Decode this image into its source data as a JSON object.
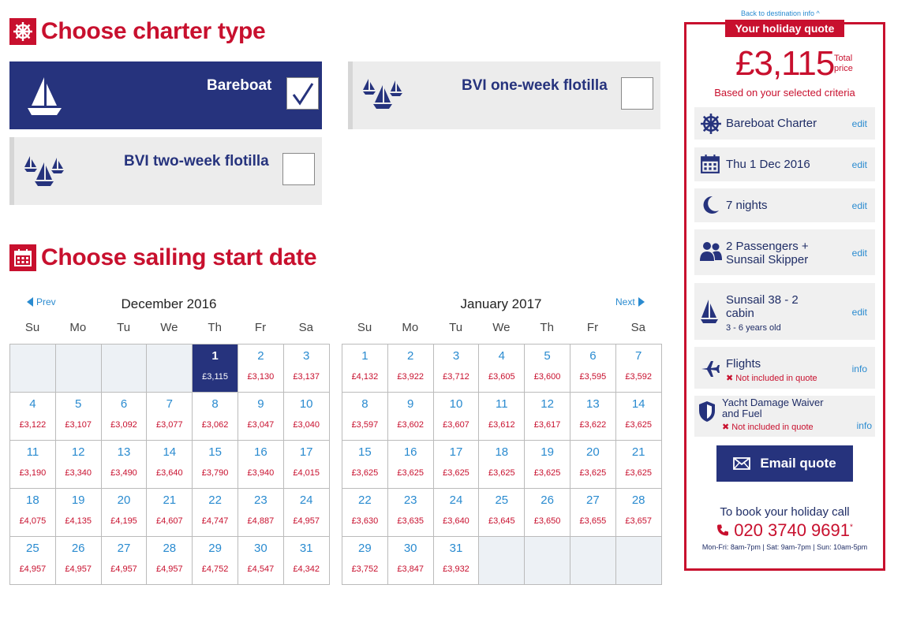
{
  "charter_section": {
    "title": "Choose charter type"
  },
  "charter_types": [
    {
      "label": "Bareboat",
      "selected": true
    },
    {
      "label": "BVI one-week flotilla",
      "selected": false
    },
    {
      "label": "BVI two-week flotilla",
      "selected": false
    }
  ],
  "date_section": {
    "title": "Choose sailing start date"
  },
  "nav": {
    "prev": "Prev",
    "next": "Next"
  },
  "days_of_week": [
    "Su",
    "Mo",
    "Tu",
    "We",
    "Th",
    "Fr",
    "Sa"
  ],
  "calendars": [
    {
      "month": "December 2016",
      "weeks": [
        [
          null,
          null,
          null,
          null,
          {
            "day": "1",
            "price": "£3,115",
            "selected": true
          },
          {
            "day": "2",
            "price": "£3,130"
          },
          {
            "day": "3",
            "price": "£3,137"
          }
        ],
        [
          {
            "day": "4",
            "price": "£3,122"
          },
          {
            "day": "5",
            "price": "£3,107"
          },
          {
            "day": "6",
            "price": "£3,092"
          },
          {
            "day": "7",
            "price": "£3,077"
          },
          {
            "day": "8",
            "price": "£3,062"
          },
          {
            "day": "9",
            "price": "£3,047"
          },
          {
            "day": "10",
            "price": "£3,040"
          }
        ],
        [
          {
            "day": "11",
            "price": "£3,190"
          },
          {
            "day": "12",
            "price": "£3,340"
          },
          {
            "day": "13",
            "price": "£3,490"
          },
          {
            "day": "14",
            "price": "£3,640"
          },
          {
            "day": "15",
            "price": "£3,790"
          },
          {
            "day": "16",
            "price": "£3,940"
          },
          {
            "day": "17",
            "price": "£4,015"
          }
        ],
        [
          {
            "day": "18",
            "price": "£4,075"
          },
          {
            "day": "19",
            "price": "£4,135"
          },
          {
            "day": "20",
            "price": "£4,195"
          },
          {
            "day": "21",
            "price": "£4,607"
          },
          {
            "day": "22",
            "price": "£4,747"
          },
          {
            "day": "23",
            "price": "£4,887"
          },
          {
            "day": "24",
            "price": "£4,957"
          }
        ],
        [
          {
            "day": "25",
            "price": "£4,957"
          },
          {
            "day": "26",
            "price": "£4,957"
          },
          {
            "day": "27",
            "price": "£4,957"
          },
          {
            "day": "28",
            "price": "£4,957"
          },
          {
            "day": "29",
            "price": "£4,752"
          },
          {
            "day": "30",
            "price": "£4,547"
          },
          {
            "day": "31",
            "price": "£4,342"
          }
        ]
      ]
    },
    {
      "month": "January 2017",
      "weeks": [
        [
          {
            "day": "1",
            "price": "£4,132"
          },
          {
            "day": "2",
            "price": "£3,922"
          },
          {
            "day": "3",
            "price": "£3,712"
          },
          {
            "day": "4",
            "price": "£3,605"
          },
          {
            "day": "5",
            "price": "£3,600"
          },
          {
            "day": "6",
            "price": "£3,595"
          },
          {
            "day": "7",
            "price": "£3,592"
          }
        ],
        [
          {
            "day": "8",
            "price": "£3,597"
          },
          {
            "day": "9",
            "price": "£3,602"
          },
          {
            "day": "10",
            "price": "£3,607"
          },
          {
            "day": "11",
            "price": "£3,612"
          },
          {
            "day": "12",
            "price": "£3,617"
          },
          {
            "day": "13",
            "price": "£3,622"
          },
          {
            "day": "14",
            "price": "£3,625"
          }
        ],
        [
          {
            "day": "15",
            "price": "£3,625"
          },
          {
            "day": "16",
            "price": "£3,625"
          },
          {
            "day": "17",
            "price": "£3,625"
          },
          {
            "day": "18",
            "price": "£3,625"
          },
          {
            "day": "19",
            "price": "£3,625"
          },
          {
            "day": "20",
            "price": "£3,625"
          },
          {
            "day": "21",
            "price": "£3,625"
          }
        ],
        [
          {
            "day": "22",
            "price": "£3,630"
          },
          {
            "day": "23",
            "price": "£3,635"
          },
          {
            "day": "24",
            "price": "£3,640"
          },
          {
            "day": "25",
            "price": "£3,645"
          },
          {
            "day": "26",
            "price": "£3,650"
          },
          {
            "day": "27",
            "price": "£3,655"
          },
          {
            "day": "28",
            "price": "£3,657"
          }
        ],
        [
          {
            "day": "29",
            "price": "£3,752"
          },
          {
            "day": "30",
            "price": "£3,847"
          },
          {
            "day": "31",
            "price": "£3,932"
          },
          null,
          null,
          null,
          null
        ]
      ]
    }
  ],
  "quote": {
    "back_link": "Back to destination info ^",
    "badge": "Your holiday quote",
    "price": "£3,115",
    "price_label_1": "Total",
    "price_label_2": "price",
    "criteria": "Based on your selected criteria",
    "rows": {
      "charter": {
        "text": "Bareboat Charter",
        "action": "edit",
        "icon": "helm-icon"
      },
      "date": {
        "text": "Thu 1 Dec 2016",
        "action": "edit",
        "icon": "calendar-icon"
      },
      "nights": {
        "text": "7 nights",
        "action": "edit",
        "icon": "moon-icon"
      },
      "passengers": {
        "line1": "2 Passengers +",
        "line2": "Sunsail Skipper",
        "action": "edit",
        "icon": "people-icon"
      },
      "yacht": {
        "line1": "Sunsail 38 - 2",
        "line2": "cabin",
        "sub": "3 - 6 years old",
        "action": "edit",
        "icon": "sailboat-icon"
      },
      "flights": {
        "text": "Flights",
        "note": "Not included in quote",
        "action": "info",
        "icon": "plane-icon"
      },
      "waiver": {
        "line1": "Yacht Damage Waiver",
        "line2": "and Fuel",
        "note": "Not included in quote",
        "action": "info",
        "icon": "shield-icon"
      }
    },
    "email_button": "Email quote",
    "book_text": "To book your holiday call",
    "phone": "020 3740 9691",
    "phone_mark": "*",
    "hours": "Mon-Fri: 8am-7pm | Sat: 9am-7pm | Sun: 10am-5pm"
  },
  "colors": {
    "brand_red": "#c8102e",
    "navy": "#26337d",
    "link_blue": "#2a8bd0"
  }
}
